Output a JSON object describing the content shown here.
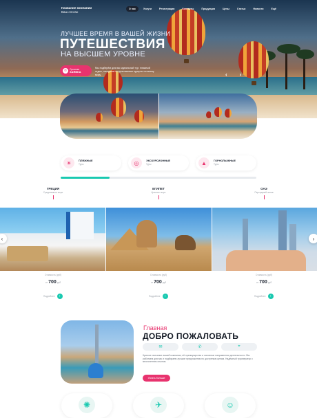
{
  "header": {
    "logo_line1": "Название компании",
    "logo_line2": "Ваш слоган",
    "nav": [
      "О нас",
      "Услуги",
      "Регистрация",
      "Контакты",
      "Продукция",
      "Цены",
      "Статьи",
      "Новости",
      "Ещё"
    ]
  },
  "hero": {
    "line1": "ЛУЧШЕЕ ВРЕМЯ В ВАШЕЙ ЖИЗНИ",
    "line2": "ПУТЕШЕСТВИЯ",
    "line3": "НА ВЫСШЕМ УРОВНЕ",
    "cta_small": "Срочная",
    "cta_big": "ЗАЯВКА",
    "text": "Мы подберём для вас идеальный тур: пляжный отдых, экскурсии и горнолыжные курорты по всему миру.",
    "prev_icon": "chevron-left-icon",
    "next_icon": "chevron-right-icon"
  },
  "categories": [
    {
      "title": "ПЛЯЖНЫЕ",
      "subtitle": "Туры",
      "icon": "palm-icon"
    },
    {
      "title": "ЭКСКУРСИОННЫЕ",
      "subtitle": "Туры",
      "icon": "camera-icon"
    },
    {
      "title": "ГОРНОЛЫЖНЫЕ",
      "subtitle": "Туры",
      "icon": "mountain-icon"
    }
  ],
  "progress": 0.25,
  "destinations": [
    {
      "name": "ГРЕЦИЯ",
      "subtitle": "Средиземное море",
      "price_label": "Стоимость (руб)",
      "price_prefix": "от",
      "price": "700",
      "price_unit": "руб",
      "more": "Подробнее"
    },
    {
      "name": "ЕГИПЕТ",
      "subtitle": "Красное море",
      "price_label": "Стоимость (руб)",
      "price_prefix": "от",
      "price": "700",
      "price_unit": "руб",
      "more": "Подробнее"
    },
    {
      "name": "ОАЭ",
      "subtitle": "Персидский залив",
      "price_label": "Стоимость (руб)",
      "price_prefix": "от",
      "price": "700",
      "price_unit": "руб",
      "more": "Подробнее"
    }
  ],
  "welcome": {
    "small": "Главная",
    "title": "ДОБРО ПОЖАЛОВАТЬ",
    "contacts": [
      "email-icon",
      "phone-icon",
      "location-icon"
    ],
    "text": "Краткое описание вашей компании, её преимущества и основные направления деятельности. Мы работаем для вас и подбираем лучшие предложения по доступным ценам. Надёжный туроператор с многолетним опытом.",
    "button": "Узнать больше"
  },
  "features": [
    "globe-icon",
    "passport-icon",
    "support-icon"
  ]
}
